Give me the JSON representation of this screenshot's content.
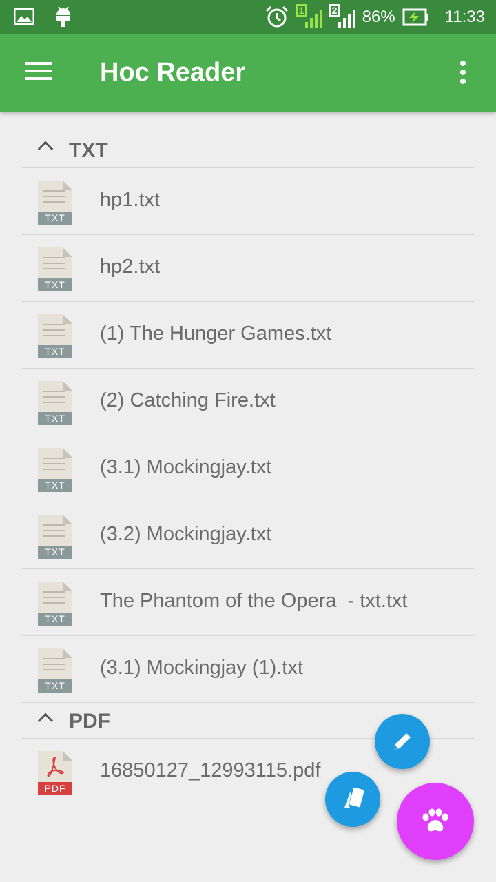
{
  "status_bar": {
    "battery": "86%",
    "time": "11:33",
    "sim1": "1",
    "sim2": "2",
    "icons": [
      "image-icon",
      "android-icon",
      "alarm-icon",
      "signal-sim1-icon",
      "signal-sim2-icon",
      "battery-charging-icon"
    ]
  },
  "app_bar": {
    "title": "Hoc Reader",
    "menu_icon": "hamburger-menu-icon",
    "overflow_icon": "more-vert-icon"
  },
  "sections": [
    {
      "label": "TXT",
      "files": [
        {
          "name": "hp1.txt",
          "type": "TXT"
        },
        {
          "name": "hp2.txt",
          "type": "TXT"
        },
        {
          "name": "(1) The Hunger Games.txt",
          "type": "TXT"
        },
        {
          "name": "(2) Catching Fire.txt",
          "type": "TXT"
        },
        {
          "name": "(3.1) Mockingjay.txt",
          "type": "TXT"
        },
        {
          "name": "(3.2) Mockingjay.txt",
          "type": "TXT"
        },
        {
          "name": "The Phantom of the Opera  - txt.txt",
          "type": "TXT"
        },
        {
          "name": "(3.1) Mockingjay (1).txt",
          "type": "TXT"
        }
      ]
    },
    {
      "label": "PDF",
      "files": [
        {
          "name": "16850127_12993115.pdf",
          "type": "PDF"
        }
      ]
    }
  ],
  "fabs": {
    "edit_icon": "pencil-icon",
    "cards_icon": "cards-icon",
    "paw_icon": "paw-icon"
  },
  "colors": {
    "status_bar": "#3a8a3e",
    "app_bar": "#4caf50",
    "fab_blue": "#1e9be0",
    "fab_purple": "#e040fb",
    "pdf_red": "#d84040"
  }
}
